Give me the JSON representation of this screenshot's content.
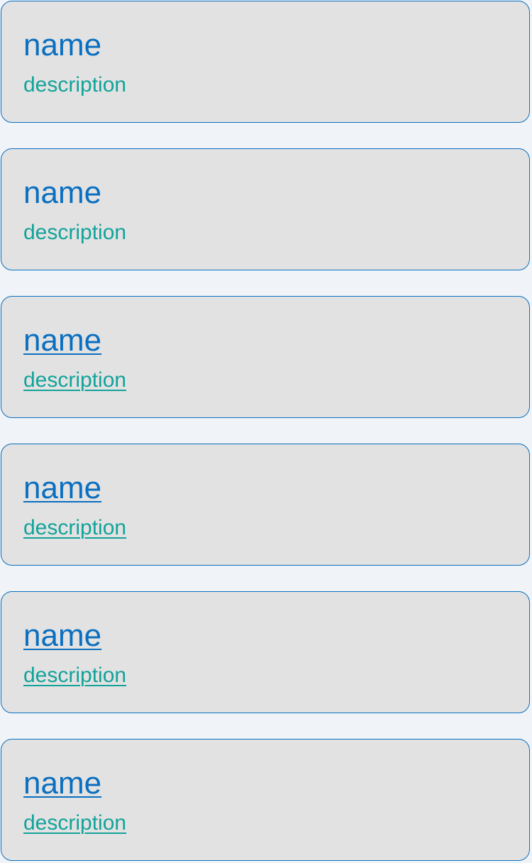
{
  "list": {
    "items": [
      {
        "name": "name",
        "description": "description"
      },
      {
        "name": "name",
        "description": "description"
      },
      {
        "name": "name",
        "description": "description"
      },
      {
        "name": "name",
        "description": "description"
      },
      {
        "name": "name",
        "description": "description"
      },
      {
        "name": "name",
        "description": "description"
      }
    ]
  },
  "colors": {
    "page_background": "#f0f4f8",
    "card_background": "#e2e2e2",
    "card_border": "#0a6fc0",
    "name_text": "#0a6fc0",
    "description_text": "#12a39a"
  }
}
